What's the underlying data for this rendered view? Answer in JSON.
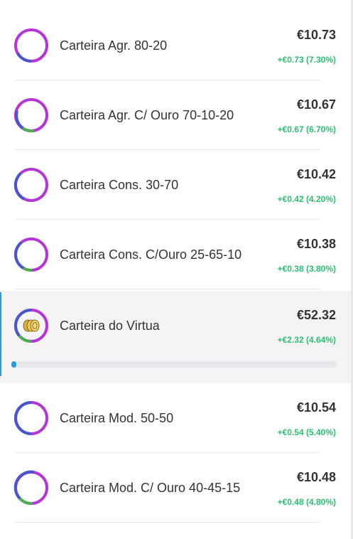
{
  "portfolios": [
    {
      "name": "Carteira Agr. 80-20",
      "value": "€10.73",
      "change": "+€0.73 (7.30%)",
      "icon": "allocation-donut-icon"
    },
    {
      "name": "Carteira Agr. C/ Ouro 70-10-20",
      "value": "€10.67",
      "change": "+€0.67 (6.70%)",
      "icon": "allocation-donut-icon"
    },
    {
      "name": "Carteira Cons. 30-70",
      "value": "€10.42",
      "change": "+€0.42 (4.20%)",
      "icon": "allocation-donut-icon"
    },
    {
      "name": "Carteira Cons. C/Ouro 25-65-10",
      "value": "€10.38",
      "change": "+€0.38 (3.80%)",
      "icon": "allocation-donut-icon"
    },
    {
      "name": "Carteira do Virtua",
      "value": "€52.32",
      "change": "+€2.32 (4.64%)",
      "icon": "gold-coins-icon",
      "progress": 0.01
    },
    {
      "name": "Carteira Mod. 50-50",
      "value": "€10.54",
      "change": "+€0.54 (5.40%)",
      "icon": "allocation-donut-icon"
    },
    {
      "name": "Carteira Mod. C/ Ouro 40-45-15",
      "value": "€10.48",
      "change": "+€0.48 (4.80%)",
      "icon": "allocation-donut-icon"
    }
  ],
  "colors": {
    "purple": "#b535d6",
    "blue": "#4757c9",
    "green": "#4caf50",
    "positive": "#2bbf73",
    "accent": "#2a9cdc",
    "gold": "#e3c04d"
  }
}
